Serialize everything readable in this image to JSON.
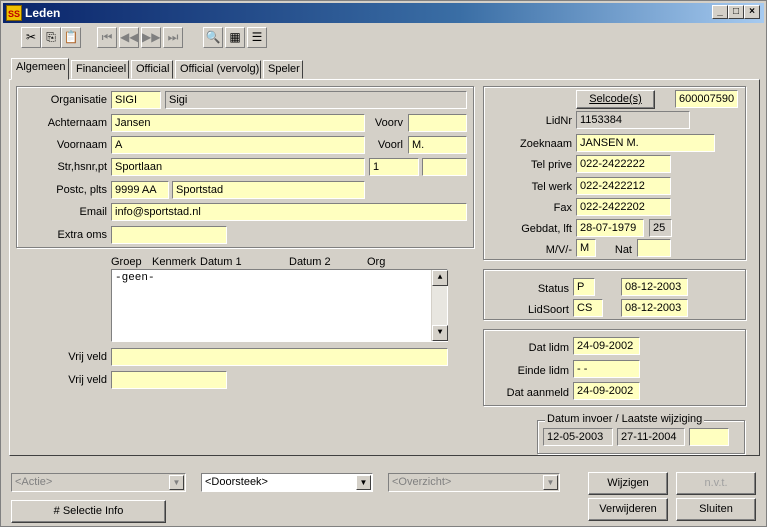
{
  "window": {
    "title": "Leden",
    "icon_text": "SS",
    "controls": [
      "_",
      "□",
      "×"
    ]
  },
  "toolbar": {
    "icons": [
      "scissors-icon",
      "copy-icon",
      "paste-icon",
      "first-icon",
      "prev-icon",
      "next-icon",
      "last-icon",
      "search-icon",
      "grid-icon",
      "list-icon"
    ]
  },
  "tabs": [
    "Algemeen",
    "Financieel",
    "Official",
    "Official (vervolg)",
    "Speler"
  ],
  "left": {
    "organisatie_label": "Organisatie",
    "organisatie_code": "SIGI",
    "organisatie_naam": "Sigi",
    "achternaam_label": "Achternaam",
    "achternaam": "Jansen",
    "voorv_label": "Voorv",
    "voorv": "",
    "voornaam_label": "Voornaam",
    "voornaam": "A",
    "voorl_label": "Voorl",
    "voorl": "M.",
    "adres_label": "Str,hsnr,pt",
    "straat": "Sportlaan",
    "huisnr": "1",
    "toev": "",
    "postc_label": "Postc, plts",
    "postcode": "9999 AA",
    "plaats": "Sportstad",
    "email_label": "Email",
    "email": "info@sportstad.nl",
    "extra_label": "Extra oms",
    "extra": ""
  },
  "memo": {
    "headers": [
      "Groep",
      "Kenmerk",
      "Datum 1",
      "Datum 2",
      "Org"
    ],
    "text": "-geen-"
  },
  "vrij": {
    "label1": "Vrij veld",
    "value1": "",
    "label2": "Vrij veld",
    "value2": ""
  },
  "right": {
    "selcode_button": "Selcode(s)",
    "selcode_value": "600007590",
    "lidnr_label": "LidNr",
    "lidnr": "1153384",
    "zoeknaam_label": "Zoeknaam",
    "zoeknaam": "JANSEN M.",
    "telprive_label": "Tel prive",
    "telprive": "022-2422222",
    "telwerk_label": "Tel werk",
    "telwerk": "022-2422212",
    "fax_label": "Fax",
    "fax": "022-2422202",
    "gebdat_label": "Gebdat, lft",
    "gebdat": "28-07-1979",
    "leeftijd": "25",
    "mv_label": "M/V/-",
    "mv": "M",
    "nat_label": "Nat",
    "nat": ""
  },
  "status": {
    "status_label": "Status",
    "status": "P",
    "status_date": "08-12-2003",
    "lidsoort_label": "LidSoort",
    "lidsoort": "CS",
    "lidsoort_date": "08-12-2003"
  },
  "dates": {
    "datlidm_label": "Dat lidm",
    "datlidm": "24-09-2002",
    "eindelidm_label": "Einde lidm",
    "eindelidm": " - -",
    "aanmeld_label": "Dat aanmeld",
    "aanmeld": "24-09-2002"
  },
  "invoer": {
    "legend": "Datum invoer / Laatste wijziging",
    "invoer": "12-05-2003",
    "wijziging": "27-11-2004",
    "extra": ""
  },
  "bottom": {
    "actie": "<Actie>",
    "doorsteek": "<Doorsteek>",
    "overzicht": "<Overzicht>",
    "selectie_info": "# Selectie Info",
    "wijzigen": "Wijzigen",
    "nvt": "n.v.t.",
    "verwijderen": "Verwijderen",
    "sluiten": "Sluiten"
  }
}
